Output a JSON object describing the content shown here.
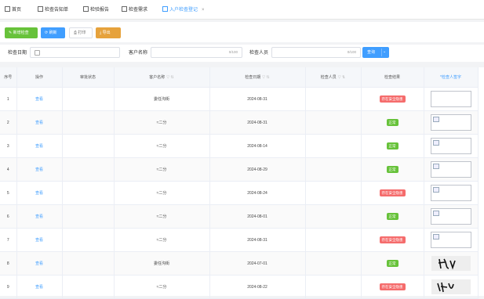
{
  "tabs": [
    {
      "label": "首页",
      "active": false
    },
    {
      "label": "检查告知单",
      "active": false
    },
    {
      "label": "检验报告",
      "active": false
    },
    {
      "label": "检查需求",
      "active": false
    },
    {
      "label": "入户检查登记",
      "active": true,
      "close": "×"
    }
  ],
  "toolbar": {
    "add_label": "新增检查",
    "refresh_label": "刷新",
    "print_label": "打印",
    "export_label": "导出"
  },
  "filters": {
    "date_label": "检查日期",
    "customer_label": "客户名称",
    "customer_count": "0/100",
    "inspector_label": "检查人员",
    "inspector_count": "0/100",
    "query_label": "查询"
  },
  "table": {
    "headers": {
      "index": "序号",
      "action": "操作",
      "review": "审批状态",
      "customer": "客户名称",
      "date": "检查日期",
      "inspector": "检查人员",
      "result": "检查结果",
      "signature": "*检查人签字"
    },
    "rows": [
      {
        "index": "1",
        "action": "查看",
        "review": "",
        "customer": "委任沟街",
        "date": "2024-08-31",
        "inspector": "",
        "result": "存在安全隐患",
        "result_type": "danger",
        "signature": "empty"
      },
      {
        "index": "2",
        "action": "查看",
        "review": "",
        "customer": "≈二分",
        "date": "2024-08-31",
        "inspector": "",
        "result": "正常",
        "result_type": "ok",
        "signature": "broken"
      },
      {
        "index": "3",
        "action": "查看",
        "review": "",
        "customer": "≈二分",
        "date": "2024-08-14",
        "inspector": "",
        "result": "正常",
        "result_type": "ok",
        "signature": "broken"
      },
      {
        "index": "4",
        "action": "查看",
        "review": "",
        "customer": "≈二分",
        "date": "2024-08-29",
        "inspector": "",
        "result": "正常",
        "result_type": "ok",
        "signature": "broken"
      },
      {
        "index": "5",
        "action": "查看",
        "review": "",
        "customer": "≈二分",
        "date": "2024-08-24",
        "inspector": "",
        "result": "存在安全隐患",
        "result_type": "danger",
        "signature": "broken"
      },
      {
        "index": "6",
        "action": "查看",
        "review": "",
        "customer": "≈二分",
        "date": "2024-08-01",
        "inspector": "",
        "result": "正常",
        "result_type": "ok",
        "signature": "broken"
      },
      {
        "index": "7",
        "action": "查看",
        "review": "",
        "customer": "≈二分",
        "date": "2024-08-31",
        "inspector": "",
        "result": "存在安全隐患",
        "result_type": "danger",
        "signature": "broken"
      },
      {
        "index": "8",
        "action": "查看",
        "review": "",
        "customer": "委任沟街",
        "date": "2024-07-01",
        "inspector": "",
        "result": "正常",
        "result_type": "ok",
        "signature": "drawn"
      },
      {
        "index": "9",
        "action": "查看",
        "review": "",
        "customer": "≈二分",
        "date": "2024-08-22",
        "inspector": "",
        "result": "存在安全隐患",
        "result_type": "danger",
        "signature": "drawn"
      }
    ]
  },
  "colors": {
    "primary": "#409eff",
    "success": "#67c23a",
    "danger": "#f56c6c",
    "warning": "#e6a23c"
  }
}
